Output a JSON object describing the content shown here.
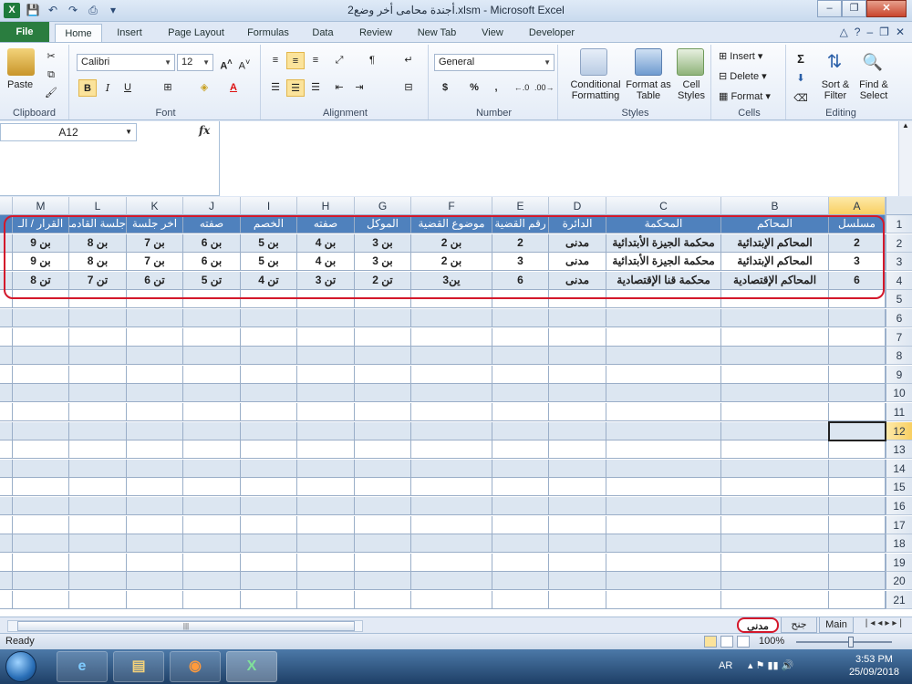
{
  "window": {
    "title": "أجندة محامى أخر وضع2.xlsm - Microsoft Excel",
    "app_letter": "X"
  },
  "tabs": [
    {
      "label": "File"
    },
    {
      "label": "Home"
    },
    {
      "label": "Insert"
    },
    {
      "label": "Page Layout"
    },
    {
      "label": "Formulas"
    },
    {
      "label": "Data"
    },
    {
      "label": "Review"
    },
    {
      "label": "New Tab"
    },
    {
      "label": "View"
    },
    {
      "label": "Developer"
    }
  ],
  "ribbon": {
    "clipboard": {
      "label": "Clipboard",
      "paste": "Paste"
    },
    "font": {
      "label": "Font",
      "name": "Calibri",
      "size": "12",
      "bold": "B",
      "italic": "I",
      "underline": "U"
    },
    "alignment": {
      "label": "Alignment"
    },
    "number": {
      "label": "Number",
      "format": "General",
      "currency": "$",
      "percent": "%",
      "comma": ","
    },
    "styles": {
      "label": "Styles",
      "conditional": "Conditional Formatting",
      "format_table": "Format as Table",
      "cell_styles": "Cell Styles"
    },
    "cells": {
      "label": "Cells",
      "insert": "Insert",
      "delete": "Delete",
      "format": "Format"
    },
    "editing": {
      "label": "Editing",
      "sort": "Sort & Filter",
      "find": "Find & Select"
    }
  },
  "formula_bar": {
    "name_box": "A12",
    "fx": "fx",
    "content": ""
  },
  "columns": [
    {
      "letter": "A",
      "header": "مسلسل"
    },
    {
      "letter": "B",
      "header": "المحاكم"
    },
    {
      "letter": "C",
      "header": "المحكمة"
    },
    {
      "letter": "D",
      "header": "الدائرة"
    },
    {
      "letter": "E",
      "header": "رقم القضية"
    },
    {
      "letter": "F",
      "header": "موضوع القضية"
    },
    {
      "letter": "G",
      "header": "الموكل"
    },
    {
      "letter": "H",
      "header": "صفته"
    },
    {
      "letter": "I",
      "header": "الخصم"
    },
    {
      "letter": "J",
      "header": "صفته"
    },
    {
      "letter": "K",
      "header": "اخر جلسة"
    },
    {
      "letter": "L",
      "header": "جلسة القادمة"
    },
    {
      "letter": "M",
      "header": "القرار / الـ"
    }
  ],
  "rows": [
    [
      "2",
      "المحاكم الإبتدائية",
      "محكمة الجيزة الأبتدائية",
      "مدنى",
      "2",
      "بن 2",
      "بن 3",
      "بن 4",
      "بن 5",
      "بن 6",
      "بن 7",
      "بن 8",
      "بن 9"
    ],
    [
      "3",
      "المحاكم الإبتدائية",
      "محكمة الجيزة الأبتدائية",
      "مدنى",
      "3",
      "بن 2",
      "بن 3",
      "بن 4",
      "بن 5",
      "بن 6",
      "بن 7",
      "بن 8",
      "بن 9"
    ],
    [
      "6",
      "المحاكم الإقتصادية",
      "محكمة قنا الإقتصادية",
      "مدنى",
      "6",
      "ين3",
      "تن 2",
      "تن 3",
      "تن 4",
      "تن 5",
      "تن 6",
      "تن 7",
      "تن 8"
    ]
  ],
  "row_numbers": [
    "1",
    "2",
    "3",
    "4",
    "5",
    "6",
    "7",
    "8",
    "9",
    "10",
    "11",
    "12",
    "13",
    "14",
    "15",
    "16",
    "17",
    "18",
    "19",
    "20",
    "21"
  ],
  "selected": {
    "row": "12",
    "col": "A"
  },
  "sheets": [
    {
      "label": "مدنى",
      "active": true
    },
    {
      "label": "جنح",
      "active": false
    },
    {
      "label": "Main",
      "active": false
    }
  ],
  "status": {
    "ready": "Ready",
    "zoom": "100%"
  },
  "taskbar": {
    "lang": "AR",
    "time": "3:53 PM",
    "date": "25/09/2018"
  },
  "colors": {
    "header_blue": "#4f81bd",
    "band": "#dce6f1",
    "annotation_red": "#d3182b"
  }
}
